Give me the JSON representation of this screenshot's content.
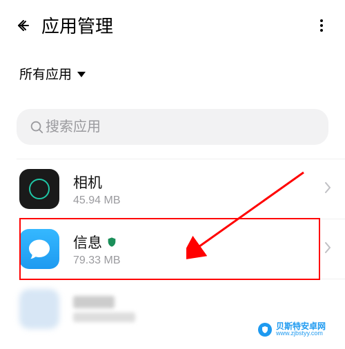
{
  "header": {
    "title": "应用管理"
  },
  "filter": {
    "label": "所有应用"
  },
  "search": {
    "placeholder": "搜索应用"
  },
  "apps": [
    {
      "name": "相机",
      "size": "45.94 MB"
    },
    {
      "name": "信息",
      "size": "79.33 MB"
    }
  ],
  "watermark": {
    "name": "贝斯特安卓网",
    "url": "www.zjbstyy.com"
  }
}
